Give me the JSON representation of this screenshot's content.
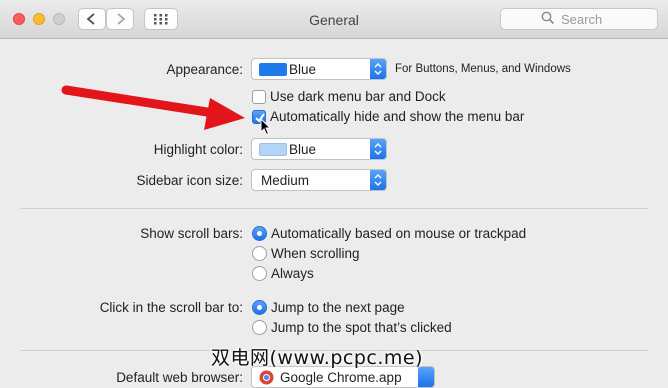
{
  "window": {
    "title": "General"
  },
  "search": {
    "placeholder": "Search"
  },
  "appearance": {
    "label": "Appearance:",
    "value": "Blue",
    "note": "For Buttons, Menus, and Windows",
    "swatch_color": "#1f7bea"
  },
  "dark_menu": {
    "label": "Use dark menu bar and Dock",
    "checked": false
  },
  "auto_hide": {
    "label": "Automatically hide and show the menu bar",
    "checked": true
  },
  "highlight": {
    "label": "Highlight color:",
    "value": "Blue",
    "swatch_color": "#b3d3f7"
  },
  "sidebar_icon": {
    "label": "Sidebar icon size:",
    "value": "Medium"
  },
  "scroll_bars": {
    "label": "Show scroll bars:",
    "options": [
      "Automatically based on mouse or trackpad",
      "When scrolling",
      "Always"
    ],
    "selected": 0
  },
  "scroll_click": {
    "label": "Click in the scroll bar to:",
    "options": [
      "Jump to the next page",
      "Jump to the spot that’s clicked"
    ],
    "selected": 0
  },
  "default_browser": {
    "label": "Default web browser:",
    "value": "Google Chrome.app"
  },
  "watermark": "双电网(www.pcpc.me)",
  "colors": {
    "accent": "#1a74ec",
    "arrow": "#e4141b"
  }
}
